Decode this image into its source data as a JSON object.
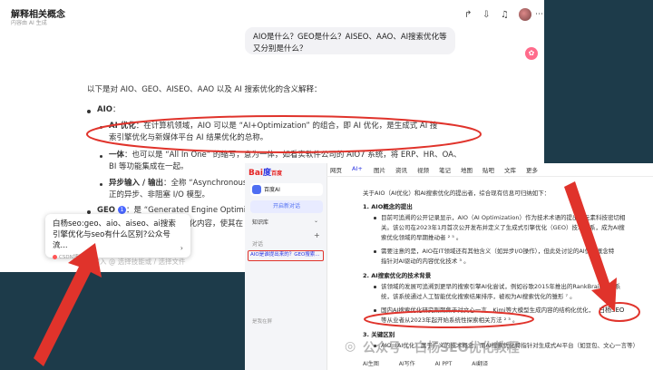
{
  "header": {
    "title": "解释相关概念",
    "subtitle": "内容由 AI 生成"
  },
  "question": "AIO是什么？GEO是什么？AISEO、AAO、AI搜索优化等又分别是什么？",
  "main": {
    "intro": "以下是对 AIO、GEO、AISEO、AAO 以及 AI 搜索优化的含义解释：",
    "aio": {
      "label": "AIO",
      "colon": "：",
      "s1_key": "AI 优化",
      "s1_l1": "：在计算机领域，AIO 可以是 “AI+Optimization” 的组合，即 AI 优化，是生成式 AI 搜",
      "s1_l2": "索引擎优化与新媒体平台 AI 结果优化的总称。",
      "s2_key": "一体",
      "s2_l1": "：也可以是 “All In One” 的缩写，意为一体，如看实软件公司的 AIO7 系统，将 ERP、HR、OA、",
      "s2_l2": "BI 等功能集成在一起。",
      "s3_key": "异步输入 / 输出",
      "s3_l1": "：全称 “Asynchronous",
      "s3_l2": "正的异步、非阻塞 I/O 模型。"
    },
    "geo": {
      "label": "GEO",
      "l1": "：是 “Generated Engine Optimization",
      "l2": "优化内容，使其在"
    },
    "input_placeholder": "消息，输入 @ 选择技能或 / 选择文件"
  },
  "card": {
    "title": "白杨seo:geo、aio、aiseo、ai搜索引擎优化与seo有什么区别?公众号流...",
    "source": "CSDN博客",
    "arrow": "›"
  },
  "baidu": {
    "logo_a": "Bai",
    "logo_b": "度",
    "logo_c": "百度",
    "nav": [
      "网页",
      "AI+",
      "图片",
      "资讯",
      "视频",
      "笔记",
      "地图",
      "贴吧",
      "文库",
      "更多"
    ],
    "ai_label": "百度AI",
    "new_chat": "开启新对话",
    "kb": "知识库",
    "kb_expand": "⌄",
    "plus": "+",
    "conv": "对话",
    "conv_item": "AIO是谁提出来的？GEO搜索...",
    "fullscreen": "是我在屏",
    "content": {
      "intro": "关于AIO（AI优化）和AI搜索优化的提出者，综合现有信息可归纳如下：",
      "h1": "1. AIO概念的提出",
      "b1": "目前可追溯的公开记录显示，AIO（AI Optimization）作为技术术语的提出与元素科技密切相",
      "b1b": "关。该公司在2023年1月首次公开发布并定义了生成式引擎优化（GEO）技术体系，成为AI搜",
      "b1c": "索优化领域的早期推动者 ² ⁵ 。",
      "b2": "需要注意的是，AIO在IT领域还有其他含义（如异步I/O操作），但此处讨论的AI优化概念特",
      "b2b": "指针对AI驱动的内容优化技术 ³ 。",
      "h2": "2. AI搜索优化的技术背景",
      "b3": "该领域的发展可追溯到更早的搜索引擎AI化尝试，例如谷歌2015年推出的RankBrain算法系",
      "b3b": "统，该系统通过人工智能优化搜索结果排序，被视为AI搜索优化的雏形 ⁷ 。",
      "b4": "国内AI搜索优化研究则聚焦于对文心一言、Kimi等大模型生成内容的结构化优化，",
      "seo": "白杨SEO",
      "b4b": "等从业者从2023年起开始系统性探索相关方法 ² ³ 。",
      "h3": "3. 关键区别",
      "b5": "AIO（AI优化）属于广义的技术概念，而AI搜索优化特指针对生成式AI平台（如豆包、文心一言等）"
    },
    "tools": [
      "AI生图",
      "AI写作",
      "AI PPT",
      "AI翻译"
    ]
  },
  "watermark": "公众号 · 白杨SEO优化教程",
  "colors": {
    "annotation_red": "#e0332b",
    "baidu_blue": "#2932e1",
    "baidu_red": "#e52323",
    "bg_dark": "#1d3b4a"
  }
}
